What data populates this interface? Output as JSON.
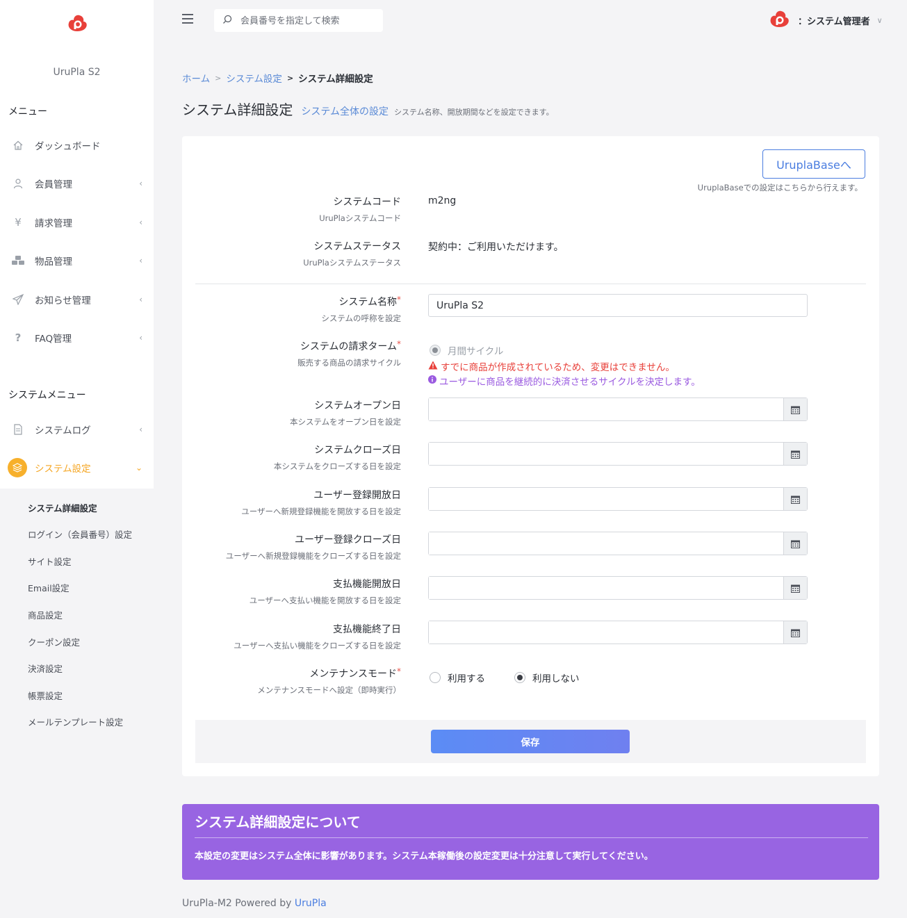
{
  "app": {
    "name": "UruPla S2",
    "brand_color": "#e8403a"
  },
  "sidebar": {
    "menu_title": "メニュー",
    "items": [
      {
        "label": "ダッシュボード",
        "icon": "home-icon"
      },
      {
        "label": "会員管理",
        "icon": "user-icon"
      },
      {
        "label": "請求管理",
        "icon": "yen-icon"
      },
      {
        "label": "物品管理",
        "icon": "cubes-icon"
      },
      {
        "label": "お知らせ管理",
        "icon": "paper-plane-icon"
      },
      {
        "label": "FAQ管理",
        "icon": "question-icon"
      }
    ],
    "system_menu_title": "システムメニュー",
    "system_items": [
      {
        "label": "システムログ",
        "icon": "document-icon"
      },
      {
        "label": "システム設定",
        "icon": "layers-icon"
      }
    ],
    "sub_items": [
      "システム詳細設定",
      "ログイン（会員番号）設定",
      "サイト設定",
      "Email設定",
      "商品設定",
      "クーポン設定",
      "決済設定",
      "帳票設定",
      "メールテンプレート設定"
    ],
    "active_color": "#f5a623"
  },
  "topbar": {
    "search_placeholder": "会員番号を指定して検索",
    "user_label": "：システム管理者"
  },
  "breadcrumb": {
    "home": "ホーム",
    "parent": "システム設定",
    "current": "システム詳細設定"
  },
  "page": {
    "title": "システム詳細設定",
    "subtitle": "システム全体の設定",
    "description": "システム名称、開放期間などを設定できます。"
  },
  "form": {
    "base_button": "UruplaBaseへ",
    "base_note": "UruplaBaseでの設定はこちらから行えます。",
    "system_code": {
      "label": "システムコード",
      "sub": "UruPlaシステムコード",
      "value": "m2ng"
    },
    "system_status": {
      "label": "システムステータス",
      "sub": "UruPlaシステムステータス",
      "value": "契約中：ご利用いただけます。"
    },
    "system_name": {
      "label": "システム名称",
      "required": "*",
      "sub": "システムの呼称を設定",
      "value": "UruPla S2"
    },
    "billing_term": {
      "label": "システムの請求ターム",
      "required": "*",
      "sub": "販売する商品の請求サイクル",
      "option": "月間サイクル",
      "warning": "すでに商品が作成されているため、変更はできません。",
      "info": "ユーザーに商品を継続的に決済させるサイクルを決定します。"
    },
    "dates": [
      {
        "label": "システムオープン日",
        "sub": "本システムをオープン日を設定",
        "value": ""
      },
      {
        "label": "システムクローズ日",
        "sub": "本システムをクローズする日を設定",
        "value": ""
      },
      {
        "label": "ユーザー登録開放日",
        "sub": "ユーザーへ新規登録機能を開放する日を設定",
        "value": ""
      },
      {
        "label": "ユーザー登録クローズ日",
        "sub": "ユーザーへ新規登録機能をクローズする日を設定",
        "value": ""
      },
      {
        "label": "支払機能開放日",
        "sub": "ユーザーへ支払い機能を開放する日を設定",
        "value": ""
      },
      {
        "label": "支払機能終了日",
        "sub": "ユーザーへ支払い機能をクローズする日を設定",
        "value": ""
      }
    ],
    "maintenance": {
      "label": "メンテナンスモード",
      "required": "*",
      "sub": "メンテナンスモードへ設定（即時実行）",
      "option_on": "利用する",
      "option_off": "利用しない",
      "selected": "利用しない"
    },
    "save_button": "保存"
  },
  "info_box": {
    "title": "システム詳細設定について",
    "text": "本設定の変更はシステム全体に影響があります。システム本稼働後の設定変更は十分注意して実行してください。",
    "color": "#9864e2"
  },
  "footer": {
    "text": "UruPla-M2 Powered by",
    "link": "UruPla"
  }
}
